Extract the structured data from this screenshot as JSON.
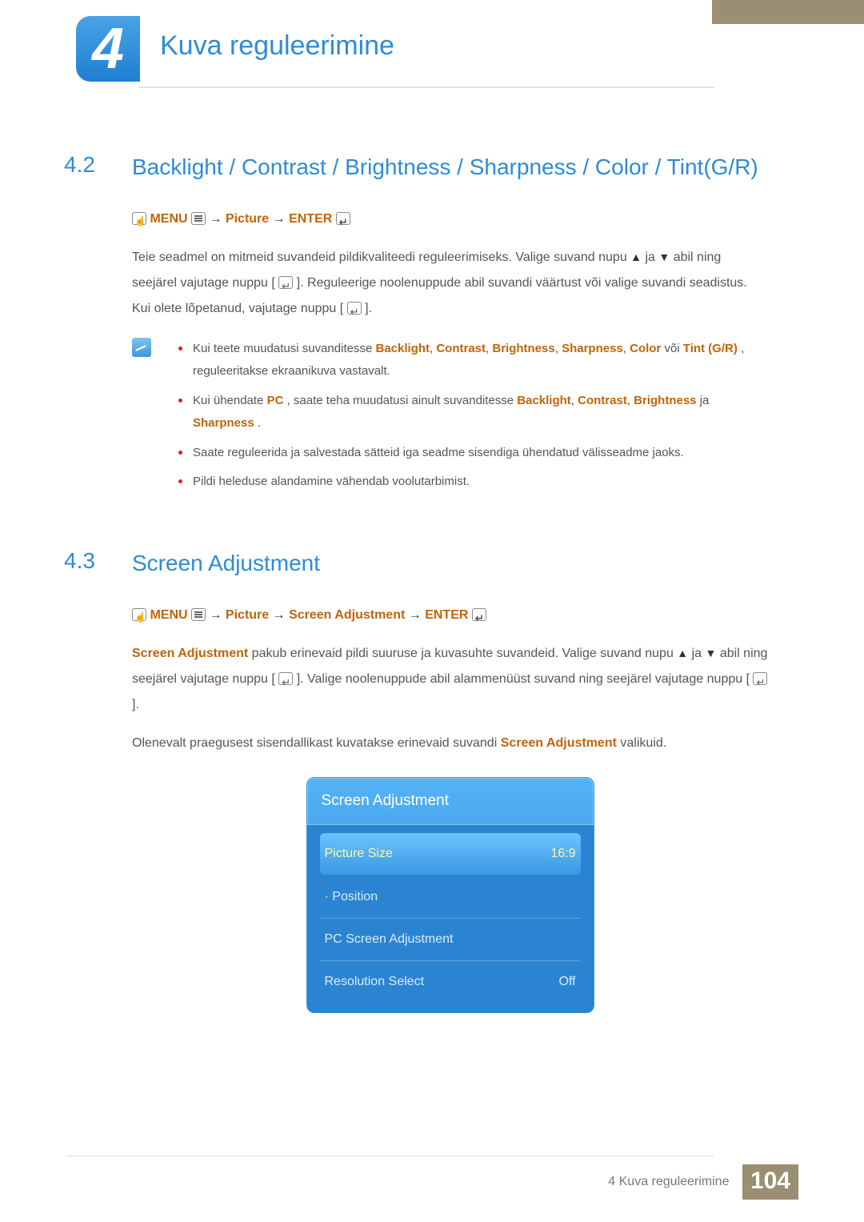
{
  "chapter": {
    "number": "4",
    "title": "Kuva reguleerimine"
  },
  "sections": {
    "s42": {
      "num": "4.2",
      "title": "Backlight / Contrast / Brightness / Sharpness / Color / Tint(G/R)",
      "menu_path": {
        "menu": "MENU",
        "arrow": "→",
        "picture": "Picture",
        "enter": "ENTER"
      },
      "para1_a": "Teie seadmel on mitmeid suvandeid pildikvaliteedi reguleerimiseks. Valige suvand nupu ",
      "para1_b": " ja ",
      "para1_c": " abil ning seejärel vajutage nuppu [",
      "para1_d": "]. Reguleerige noolenuppude abil suvandi väärtust või valige suvandi seadistus. Kui olete lõpetanud, vajutage nuppu [",
      "para1_e": "].",
      "notes": {
        "n1_a": "Kui teete muudatusi suvanditesse ",
        "n1_backlight": "Backlight",
        "n1_sep": ", ",
        "n1_contrast": "Contrast",
        "n1_brightness": "Brightness",
        "n1_sharpness": "Sharpness",
        "n1_color": "Color",
        "n1_or": " või ",
        "n1_tint": "Tint (G/R)",
        "n1_b": ", reguleeritakse ekraanikuva vastavalt.",
        "n2_a": "Kui ühendate ",
        "n2_pc": "PC",
        "n2_b": ", saate teha muudatusi ainult suvanditesse ",
        "n2_backlight": "Backlight",
        "n2_contrast": "Contrast",
        "n2_brightness": "Brightness",
        "n2_and": " ja ",
        "n2_sharpness": "Sharpness",
        "n2_dot": ".",
        "n3": "Saate reguleerida ja salvestada sätteid iga seadme sisendiga ühendatud välisseadme jaoks.",
        "n4": "Pildi heleduse alandamine vähendab voolutarbimist."
      }
    },
    "s43": {
      "num": "4.3",
      "title": "Screen Adjustment",
      "menu_path": {
        "menu": "MENU",
        "arrow": "→",
        "picture": "Picture",
        "screen_adj": "Screen Adjustment",
        "enter": "ENTER"
      },
      "para1_hl": "Screen Adjustment",
      "para1_a": " pakub erinevaid pildi suuruse ja kuvasuhte suvandeid. Valige suvand nupu ",
      "para1_b": " ja ",
      "para1_c": " abil ning seejärel vajutage nuppu [",
      "para1_d": "]. Valige noolenuppude abil alammenüüst suvand ning seejärel vajutage nuppu [",
      "para1_e": "].",
      "para2_a": "Olenevalt praegusest sisendallikast kuvatakse erinevaid suvandi ",
      "para2_hl": "Screen Adjustment",
      "para2_b": " valikuid."
    }
  },
  "osd": {
    "title": "Screen Adjustment",
    "rows": [
      {
        "label": "Picture Size",
        "value": "16:9",
        "selected": true
      },
      {
        "label": "· Position",
        "value": "",
        "selected": false
      },
      {
        "label": "PC Screen Adjustment",
        "value": "",
        "selected": false
      },
      {
        "label": "Resolution Select",
        "value": "Off",
        "selected": false
      }
    ]
  },
  "footer": {
    "prefix_num": "4",
    "text": "Kuva reguleerimine",
    "page": "104"
  }
}
